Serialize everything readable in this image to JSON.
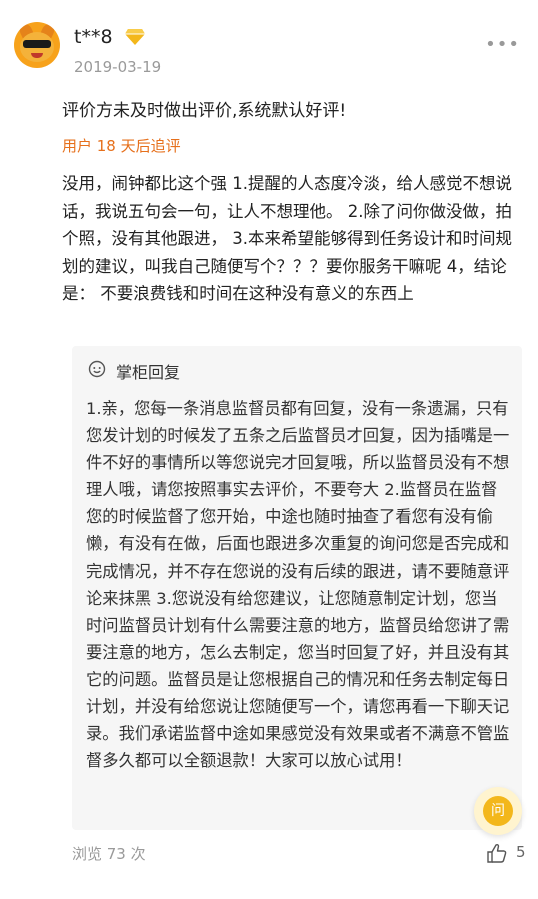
{
  "user": {
    "name": "t**8",
    "date": "2019-03-19",
    "avatar_icon": "fox-avatar",
    "badge_icon": "vip-diamond-icon"
  },
  "review": {
    "default_text": "评价方未及时做出评价,系统默认好评!",
    "followup_label": "用户 18 天后追评",
    "followup_text": "没用，闹钟都比这个强 1.提醒的人态度冷淡，给人感觉不想说话，我说五句会一句，让人不想理他。 2.除了问你做没做，拍个照，没有其他跟进， 3.本来希望能够得到任务设计和时间规划的建议，叫我自己随便写个？？？要你服务干嘛呢 4，结论是： 不要浪费钱和时间在这种没有意义的东西上"
  },
  "reply": {
    "title": "掌柜回复",
    "text": "1.亲，您每一条消息监督员都有回复，没有一条遗漏，只有您发计划的时候发了五条之后监督员才回复，因为插嘴是一件不好的事情所以等您说完才回复哦，所以监督员没有不想理人哦，请您按照事实去评价，不要夸大 2.监督员在监督您的时候监督了您开始，中途也随时抽查了看您有没有偷懒，有没有在做，后面也跟进多次重复的询问您是否完成和完成情况，并不存在您说的没有后续的跟进，请不要随意评论来抹黑 3.您说没有给您建议，让您随意制定计划，您当时问监督员计划有什么需要注意的地方，监督员给您讲了需要注意的地方，怎么去制定，您当时回复了好，并且没有其它的问题。监督员是让您根据自己的情况和任务去制定每日计划，并没有给您说让您随便写一个，请您再看一下聊天记录。我们承诺监督中途如果感觉没有效果或者不满意不管监督多久都可以全额退款！大家可以放心试用！"
  },
  "footer": {
    "views": "浏览 73 次",
    "likes": "5"
  },
  "float_button": {
    "label": "问"
  },
  "colors": {
    "accent": "#e6701c",
    "badge": "#f3b71b"
  }
}
